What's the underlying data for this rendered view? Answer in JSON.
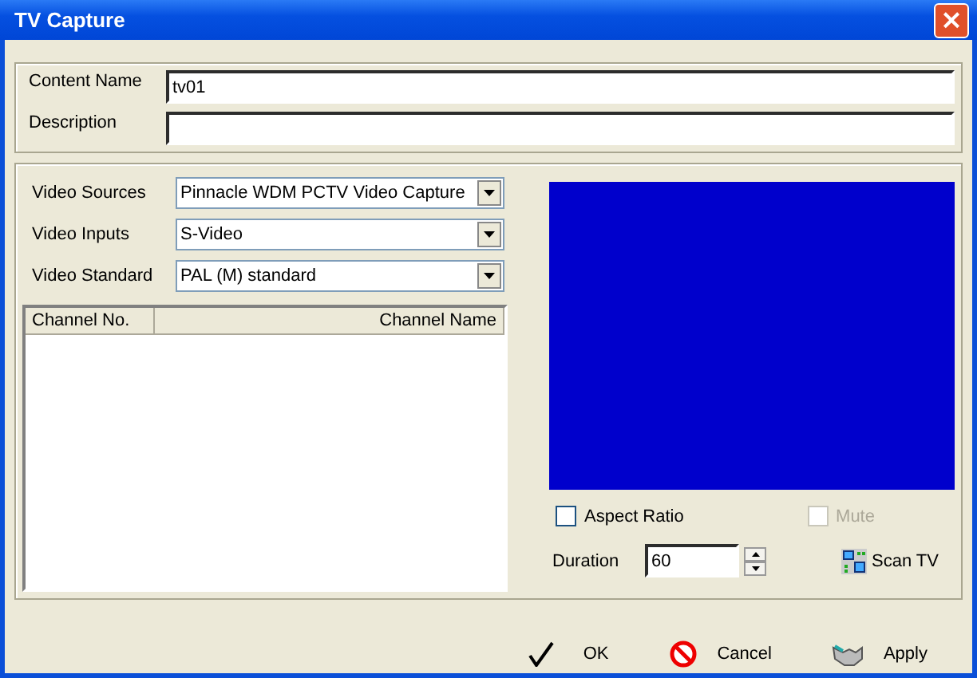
{
  "window": {
    "title": "TV Capture",
    "close": "×"
  },
  "content": {
    "fields": [
      {
        "label": "Content Name",
        "value": "tv01"
      },
      {
        "label": "Description"
      }
    ]
  },
  "sources": [
    {
      "label": "Video Sources",
      "value": "Pinnacle WDM PCTV Video Capture"
    },
    {
      "label": "Video Inputs",
      "value": "S-Video"
    },
    {
      "label": "Video Standard",
      "value": "PAL (M) standard"
    }
  ],
  "channels": {
    "columns": [
      "Channel No.",
      "Channel Name"
    ]
  },
  "options": [
    {
      "label": "Aspect Ratio",
      "checked": false,
      "disabled": false
    },
    {
      "label": "Mute",
      "checked": false,
      "disabled": true
    }
  ],
  "duration": {
    "label": "Duration",
    "value": "60"
  },
  "scan_button": "Scan TV",
  "buttons": [
    {
      "kind": "ok",
      "label": "OK"
    },
    {
      "kind": "cancel",
      "label": "Cancel"
    },
    {
      "kind": "apply",
      "label": "Apply"
    }
  ]
}
